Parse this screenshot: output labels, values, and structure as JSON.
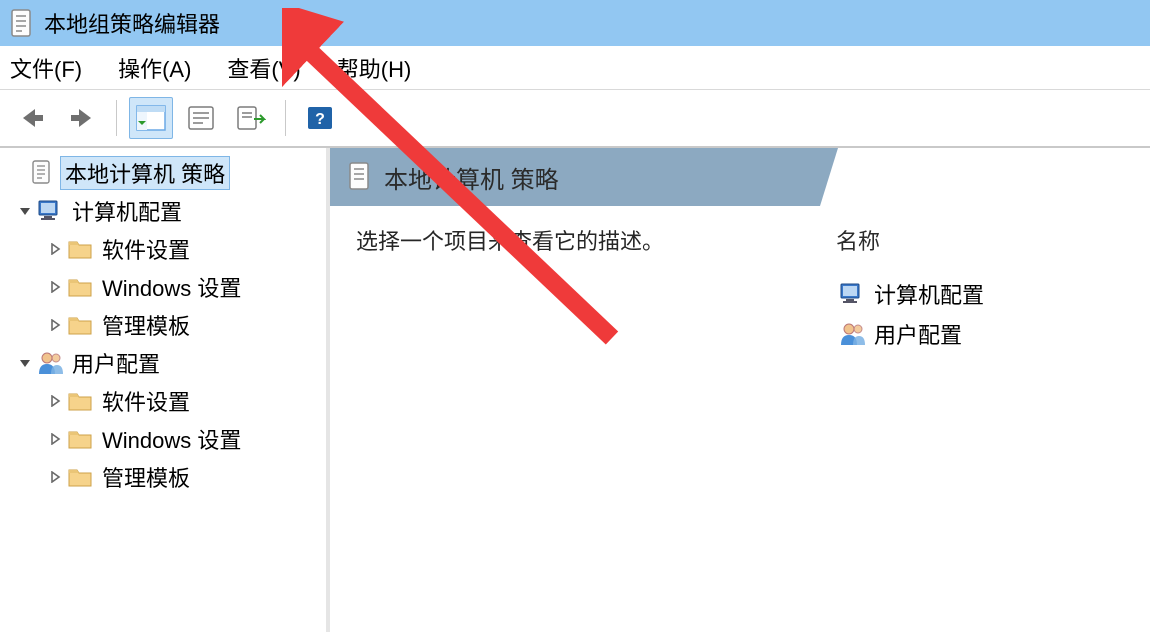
{
  "window": {
    "title": "本地组策略编辑器"
  },
  "menubar": {
    "items": [
      {
        "label": "文件(F)"
      },
      {
        "label": "操作(A)"
      },
      {
        "label": "查看(V)"
      },
      {
        "label": "帮助(H)"
      }
    ]
  },
  "tree": {
    "nodes": [
      {
        "level": 0,
        "label": "本地计算机 策略",
        "icon": "policy",
        "expandable": false,
        "expanded": false,
        "selected": true
      },
      {
        "level": 1,
        "label": "计算机配置",
        "icon": "computer",
        "expandable": true,
        "expanded": true,
        "selected": false
      },
      {
        "level": 2,
        "label": "软件设置",
        "icon": "folder",
        "expandable": true,
        "expanded": false,
        "selected": false
      },
      {
        "level": 2,
        "label": "Windows 设置",
        "icon": "folder",
        "expandable": true,
        "expanded": false,
        "selected": false
      },
      {
        "level": 2,
        "label": "管理模板",
        "icon": "folder",
        "expandable": true,
        "expanded": false,
        "selected": false
      },
      {
        "level": 1,
        "label": "用户配置",
        "icon": "user",
        "expandable": true,
        "expanded": true,
        "selected": false
      },
      {
        "level": 2,
        "label": "软件设置",
        "icon": "folder",
        "expandable": true,
        "expanded": false,
        "selected": false
      },
      {
        "level": 2,
        "label": "Windows 设置",
        "icon": "folder",
        "expandable": true,
        "expanded": false,
        "selected": false
      },
      {
        "level": 2,
        "label": "管理模板",
        "icon": "folder",
        "expandable": true,
        "expanded": false,
        "selected": false
      }
    ]
  },
  "detail": {
    "title": "本地计算机 策略",
    "description": "选择一个项目来查看它的描述。",
    "columnHeader": "名称",
    "items": [
      {
        "label": "计算机配置",
        "icon": "computer"
      },
      {
        "label": "用户配置",
        "icon": "user"
      }
    ]
  }
}
